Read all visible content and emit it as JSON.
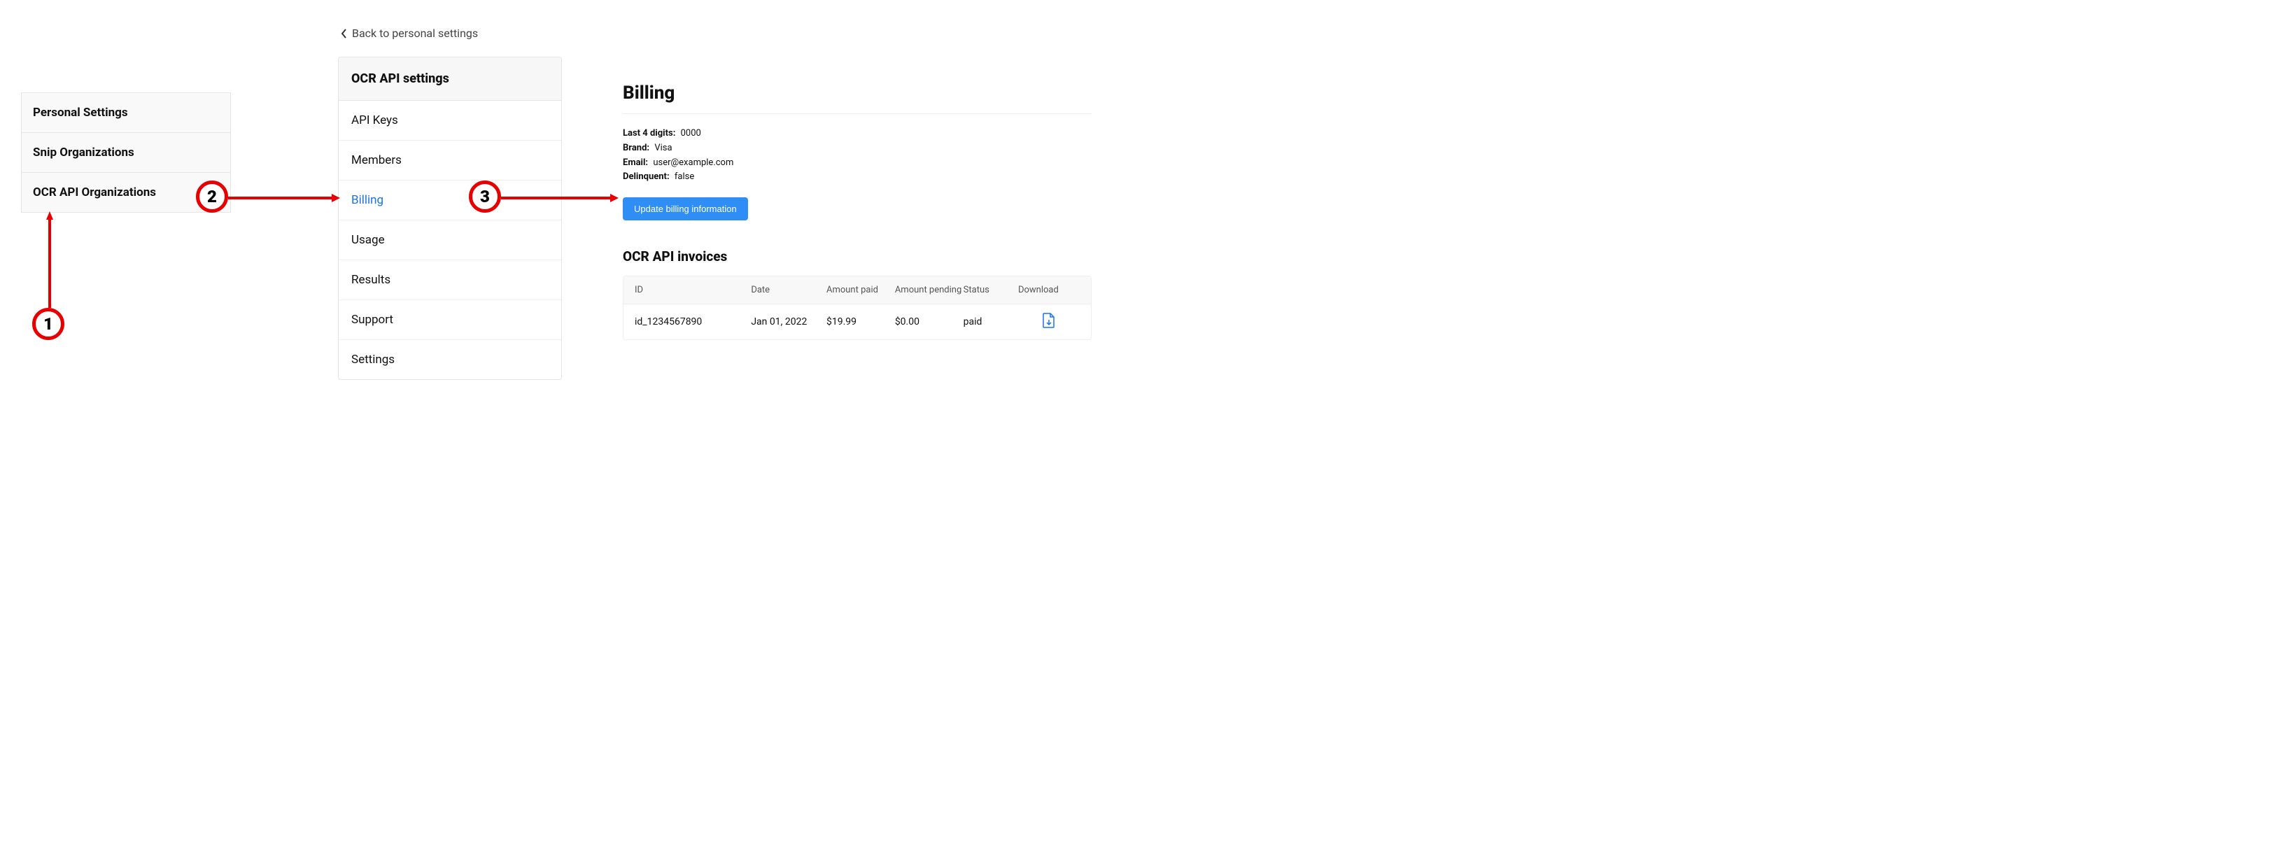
{
  "panel1": {
    "items": [
      {
        "label": "Personal Settings"
      },
      {
        "label": "Snip Organizations"
      },
      {
        "label": "OCR API Organizations"
      }
    ]
  },
  "panel2": {
    "back_label": "Back to personal settings",
    "header": "OCR API settings",
    "items": [
      {
        "label": "API Keys"
      },
      {
        "label": "Members"
      },
      {
        "label": "Billing",
        "active": true
      },
      {
        "label": "Usage"
      },
      {
        "label": "Results"
      },
      {
        "label": "Support"
      },
      {
        "label": "Settings"
      }
    ]
  },
  "billing": {
    "title": "Billing",
    "fields": {
      "last4_label": "Last 4 digits:",
      "last4_value": "0000",
      "brand_label": "Brand:",
      "brand_value": "Visa",
      "email_label": "Email:",
      "email_value": "user@example.com",
      "delinquent_label": "Delinquent:",
      "delinquent_value": "false"
    },
    "update_button": "Update billing information",
    "invoices_title": "OCR API invoices",
    "columns": {
      "id": "ID",
      "date": "Date",
      "amount_paid": "Amount paid",
      "amount_pending": "Amount pending",
      "status": "Status",
      "download": "Download"
    },
    "rows": [
      {
        "id": "id_1234567890",
        "date": "Jan 01, 2022",
        "amount_paid": "$19.99",
        "amount_pending": "$0.00",
        "status": "paid"
      }
    ]
  },
  "steps": {
    "one": "1",
    "two": "2",
    "three": "3"
  }
}
